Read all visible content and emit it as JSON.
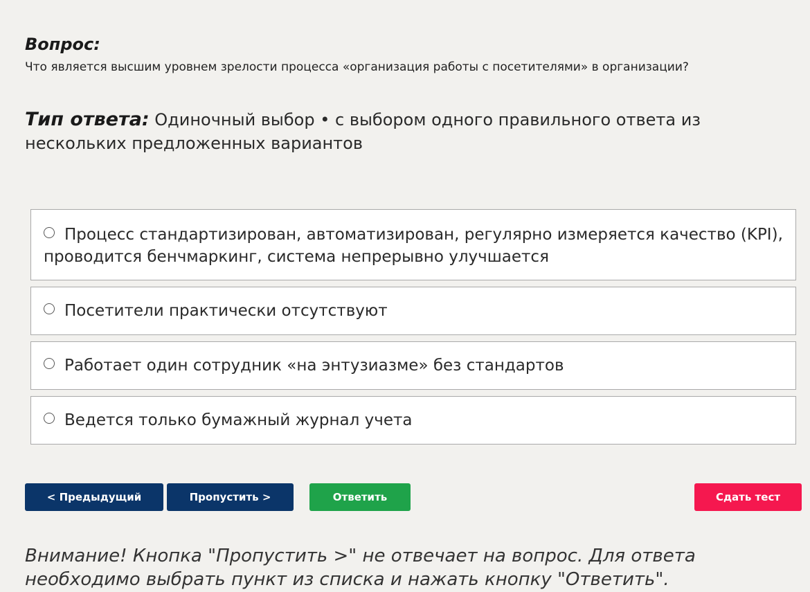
{
  "question": {
    "label": "Вопрос:",
    "text": "Что является высшим уровнем зрелости процесса «организация работы с посетителями» в организации?"
  },
  "answer_type": {
    "label": "Тип ответа:",
    "text": " Одиночный выбор • с выбором одного правильного ответа из нескольких предложенных вариантов"
  },
  "options": [
    {
      "label": "Процесс стандартизирован, автоматизирован, регулярно измеряется качество (KPI), проводится бенчмаркинг, система непрерывно улучшается"
    },
    {
      "label": "Посетители практически отсутствуют"
    },
    {
      "label": "Работает один сотрудник «на энтузиазме» без стандартов"
    },
    {
      "label": "Ведется только бумажный журнал учета"
    }
  ],
  "buttons": {
    "prev": "< Предыдущий",
    "skip": "Пропустить >",
    "answer": "Ответить",
    "submit": "Сдать тест"
  },
  "colors": {
    "nav_button": "#0b3569",
    "answer_button": "#1fa34a",
    "submit_button": "#f5184f",
    "background": "#f2f1ee"
  },
  "notice": "Внимание! Кнопка \"Пропустить >\" не отвечает на вопрос. Для ответа необходимо выбрать пункт из списка и нажать кнопку \"Ответить\"."
}
